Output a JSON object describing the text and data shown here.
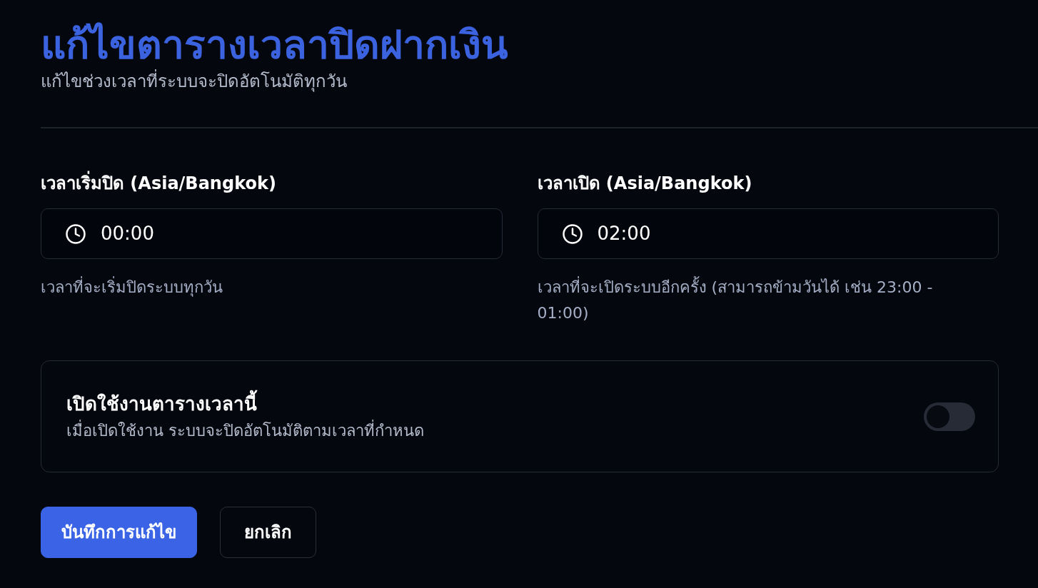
{
  "header": {
    "title": "แก้ไขตารางเวลาปิดฝากเงิน",
    "subtitle": "แก้ไขช่วงเวลาที่ระบบจะปิดอัตโนมัติทุกวัน"
  },
  "fields": [
    {
      "label": "เวลาเริ่มปิด (Asia/Bangkok)",
      "value": "00:00",
      "hint": "เวลาที่จะเริ่มปิดระบบทุกวัน"
    },
    {
      "label": "เวลาเปิด (Asia/Bangkok)",
      "value": "02:00",
      "hint": "เวลาที่จะเปิดระบบอีกครั้ง (สามารถข้ามวันได้ เช่น 23:00 - 01:00)"
    }
  ],
  "schedule_toggle": {
    "title": "เปิดใช้งานตารางเวลานี้",
    "description": "เมื่อเปิดใช้งาน ระบบจะปิดอัตโนมัติตามเวลาที่กำหนด",
    "on": false
  },
  "buttons": [
    {
      "label": "บันทึกการแก้ไข",
      "kind": "primary"
    },
    {
      "label": "ยกเลิก",
      "kind": "secondary"
    }
  ]
}
